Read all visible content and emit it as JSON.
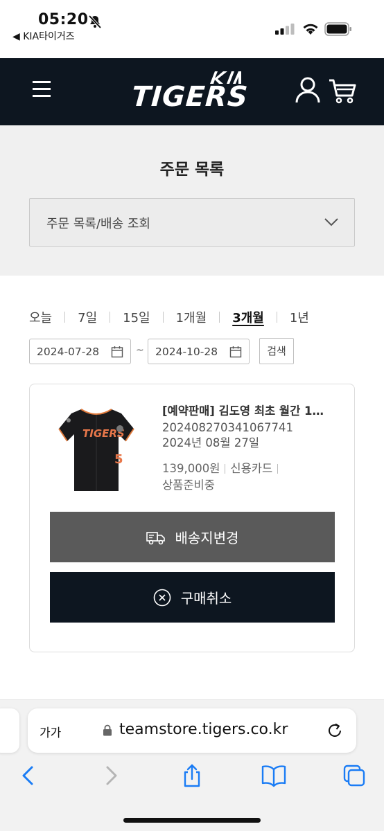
{
  "status_bar": {
    "time": "05:20",
    "back_app": "◀ KIA타이거즈"
  },
  "header": {
    "logo_text": "TIGERS",
    "logo_brand": "KIA"
  },
  "page": {
    "title": "주문 목록",
    "select_label": "주문 목록/배송 조회"
  },
  "period_tabs": [
    {
      "label": "오늘",
      "active": false
    },
    {
      "label": "7일",
      "active": false
    },
    {
      "label": "15일",
      "active": false
    },
    {
      "label": "1개월",
      "active": false
    },
    {
      "label": "3개월",
      "active": true
    },
    {
      "label": "1년",
      "active": false
    }
  ],
  "date_range": {
    "start": "2024-07-28",
    "separator": "~",
    "end": "2024-10-28",
    "search_label": "검색"
  },
  "order": {
    "product_name": "[예약판매] 김도영 최초 월간 1…",
    "order_number": "20240827034106774​1",
    "order_date": "2024년 08월 27일",
    "price": "139,000원",
    "payment": "신용카드",
    "status": "상품준비중",
    "jersey_number": "5",
    "jersey_text": "TIGERS",
    "ship_button": "배송지변경",
    "cancel_button": "구매취소"
  },
  "browser": {
    "text_size_label": "가가",
    "url": "teamstore.tigers.co.kr"
  },
  "colors": {
    "header_bg": "#0d1620",
    "ship_button_bg": "#5a5a5a",
    "cancel_button_bg": "#0d1620",
    "safari_blue": "#1a7cf5"
  }
}
